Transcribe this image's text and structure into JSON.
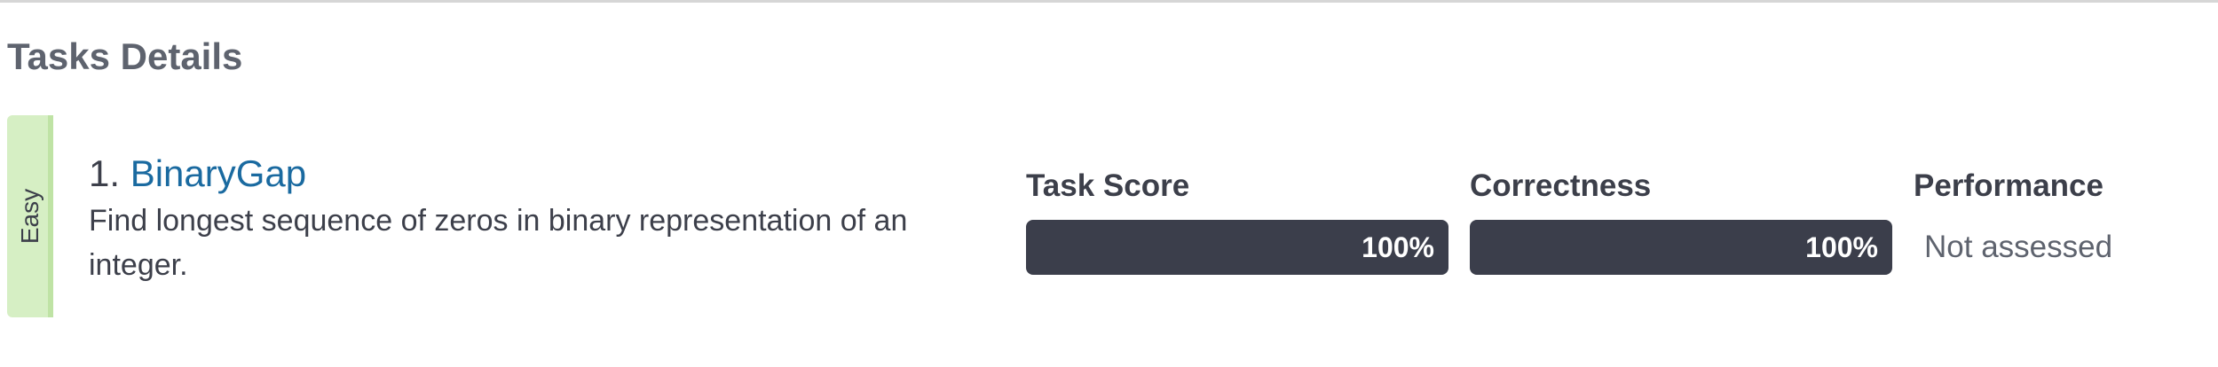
{
  "section": {
    "title": "Tasks Details"
  },
  "task": {
    "difficulty": "Easy",
    "number": "1.",
    "name": "BinaryGap",
    "description": "Find longest sequence of zeros in binary representation of an integer.",
    "accent_color": "#d6efc4",
    "link_color": "#1a6aa0"
  },
  "metrics": {
    "task_score": {
      "label": "Task Score",
      "value_text": "100%",
      "value": 100
    },
    "correctness": {
      "label": "Correctness",
      "value_text": "100%",
      "value": 100
    },
    "performance": {
      "label": "Performance",
      "status": "Not assessed"
    }
  },
  "colors": {
    "bar_fill": "#3b3e4b",
    "bar_track": "#e6e7ea",
    "text": "#3c3f4a",
    "muted": "#5e636e"
  }
}
